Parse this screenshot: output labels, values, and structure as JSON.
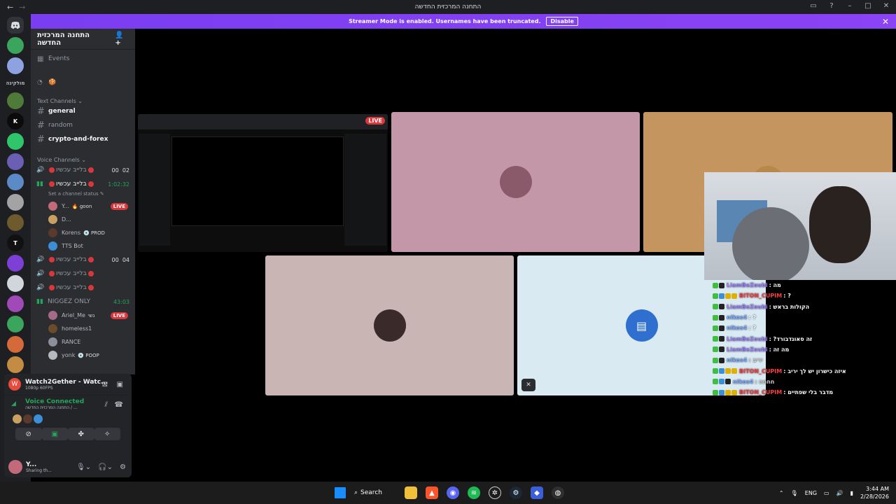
{
  "window": {
    "title": "התחנה המרכזית החדשה",
    "nav_back": "←",
    "nav_fwd": "→"
  },
  "banner": {
    "text": "Streamer Mode is enabled. Usernames have been truncated.",
    "button": "Disable",
    "close": "✕"
  },
  "servers": [
    {
      "color": "#5865f2",
      "label": ""
    },
    {
      "color": "#3ba55d",
      "label": ""
    },
    {
      "color": "#8ea1e1",
      "label": ""
    },
    {
      "color": "transparent",
      "label": "מולקיגה"
    },
    {
      "color": "#4f7a3a",
      "label": ""
    },
    {
      "color": "#0b0b0b",
      "label": "K"
    },
    {
      "color": "#2fc56b",
      "label": ""
    },
    {
      "color": "#6b5fb5",
      "label": ""
    },
    {
      "color": "#5c8ac7",
      "label": ""
    },
    {
      "color": "#a3a3a3",
      "label": ""
    },
    {
      "color": "#6d5a2d",
      "label": ""
    },
    {
      "color": "#111111",
      "label": "T"
    },
    {
      "color": "#7e3fd6",
      "label": ""
    },
    {
      "color": "#d0d6dc",
      "label": ""
    },
    {
      "color": "#a04ab7",
      "label": ""
    },
    {
      "color": "#3ba55d",
      "label": ""
    },
    {
      "color": "#d46a3a",
      "label": ""
    },
    {
      "color": "#c48b43",
      "label": ""
    }
  ],
  "sidebar": {
    "guild_name": "התחנה המרכזית החדשה",
    "events_label": "Events",
    "text_category": "Text Channels",
    "text_channels": [
      "general",
      "random",
      "crypto-and-forex"
    ],
    "voice_category": "Voice Channels",
    "voice_channels": [
      {
        "name": "בלייב עכשיו",
        "count_a": "00",
        "count_b": "02"
      },
      {
        "name": "בלייב עכשיו",
        "timer": "1:02:32",
        "status": "Set a channel status"
      },
      {
        "name": "בלייב עכשיו",
        "count_a": "00",
        "count_b": "04"
      },
      {
        "name": "בלייב עכשיו"
      },
      {
        "name": "בלייב עכשיו"
      },
      {
        "name": "NIGGEZ ONLY",
        "timer": "43:03"
      }
    ],
    "users_1": [
      {
        "name": "Y...",
        "tag": "🔥 goon",
        "live": "LIVE",
        "color": "#c26a7a"
      },
      {
        "name": "D...",
        "tag": "",
        "color": "#c9a062"
      },
      {
        "name": "Korens",
        "tag": "💿 PROD",
        "color": "#5b3a2e"
      },
      {
        "name": "TTS Bot",
        "tag": "",
        "color": "#3b8fd9"
      }
    ],
    "users_2": [
      {
        "name": "Ariel_Me",
        "tag": "נשי",
        "live": "LIVE",
        "color": "#a86a8a"
      },
      {
        "name": "homeless1",
        "tag": "",
        "color": "#6b4b2a"
      },
      {
        "name": "RANCE",
        "tag": "",
        "color": "#8a8f9a"
      },
      {
        "name": "yonk",
        "tag": "💿 POOP",
        "color": "#b5bac1"
      }
    ]
  },
  "activity": {
    "title": "Watch2Gether - Watc...",
    "subtitle": "1080p 60FPS",
    "voice_connected": "Voice Connected",
    "voice_sub": "התחנה המרכזית החדשה / ...",
    "user_name": "Y...",
    "user_sub": "Sharing th..."
  },
  "stage": {
    "live_tag": "LIVE",
    "tiles": [
      {
        "bg": "#c497a8",
        "avatar": "#8a5a6a"
      },
      {
        "bg": "#c4955f",
        "avatar": "#b8884a"
      },
      {
        "bg": "#cab5b5",
        "avatar": "#3a2a2a"
      },
      {
        "bg": "#d9eaf2",
        "avatar": "#2f6fd0"
      }
    ]
  },
  "overlay_chat": [
    {
      "name": "LiamBeZoubi",
      "name_color": "#9b7dff",
      "msg": ": מה",
      "badges": [
        "#3fbf3f",
        "#222"
      ]
    },
    {
      "name": "BITON_CUPIM",
      "name_color": "#ff3b3b",
      "msg": ": ?",
      "badges": [
        "#3fbf3f",
        "#3b8fd9",
        "#e0b000",
        "#e0b000"
      ]
    },
    {
      "name": "LiamBeZoubi",
      "name_color": "#9b7dff",
      "msg": ": הקולות בראש",
      "badges": [
        "#3fbf3f",
        "#222"
      ]
    },
    {
      "name": "nikos4",
      "name_color": "#7aa7ff",
      "msg": ": ?",
      "badges": [
        "#3fbf3f",
        "#222"
      ]
    },
    {
      "name": "nikos4",
      "name_color": "#7aa7ff",
      "msg": ": ?",
      "badges": [
        "#3fbf3f",
        "#222"
      ]
    },
    {
      "name": "LiamBeZoubi",
      "name_color": "#9b7dff",
      "msg": ": ?זה סאונדבורד",
      "badges": [
        "#3fbf3f",
        "#222"
      ]
    },
    {
      "name": "LiamBeZoubi",
      "name_color": "#9b7dff",
      "msg": ": מה זה",
      "badges": [
        "#3fbf3f",
        "#222"
      ]
    },
    {
      "name": "nikos4",
      "name_color": "#7aa7ff",
      "msg": ": יריב",
      "dim": true,
      "badges": [
        "#3fbf3f",
        "#222"
      ]
    },
    {
      "name": "BITON_CUPIM",
      "name_color": "#ff3b3b",
      "msg": ": איזה כישרון יש לך יריב",
      "badges": [
        "#3fbf3f",
        "#3b8fd9",
        "#e0b000",
        "#e0b000"
      ]
    },
    {
      "name": "nikos4",
      "name_color": "#7aa7ff",
      "msg": ": חחחח",
      "dim": true,
      "badges": [
        "#3fbf3f",
        "#3b8fd9",
        "#222"
      ]
    },
    {
      "name": "BITON_CUPIM",
      "name_color": "#ff3b3b",
      "msg": ": מדבר בלי שפתיים",
      "badges": [
        "#3fbf3f",
        "#3b8fd9",
        "#e0b000",
        "#e0b000"
      ]
    }
  ],
  "taskbar": {
    "search": "Search",
    "lang": "ENG",
    "time": "3:44 AM",
    "date": "2/28/2026"
  }
}
